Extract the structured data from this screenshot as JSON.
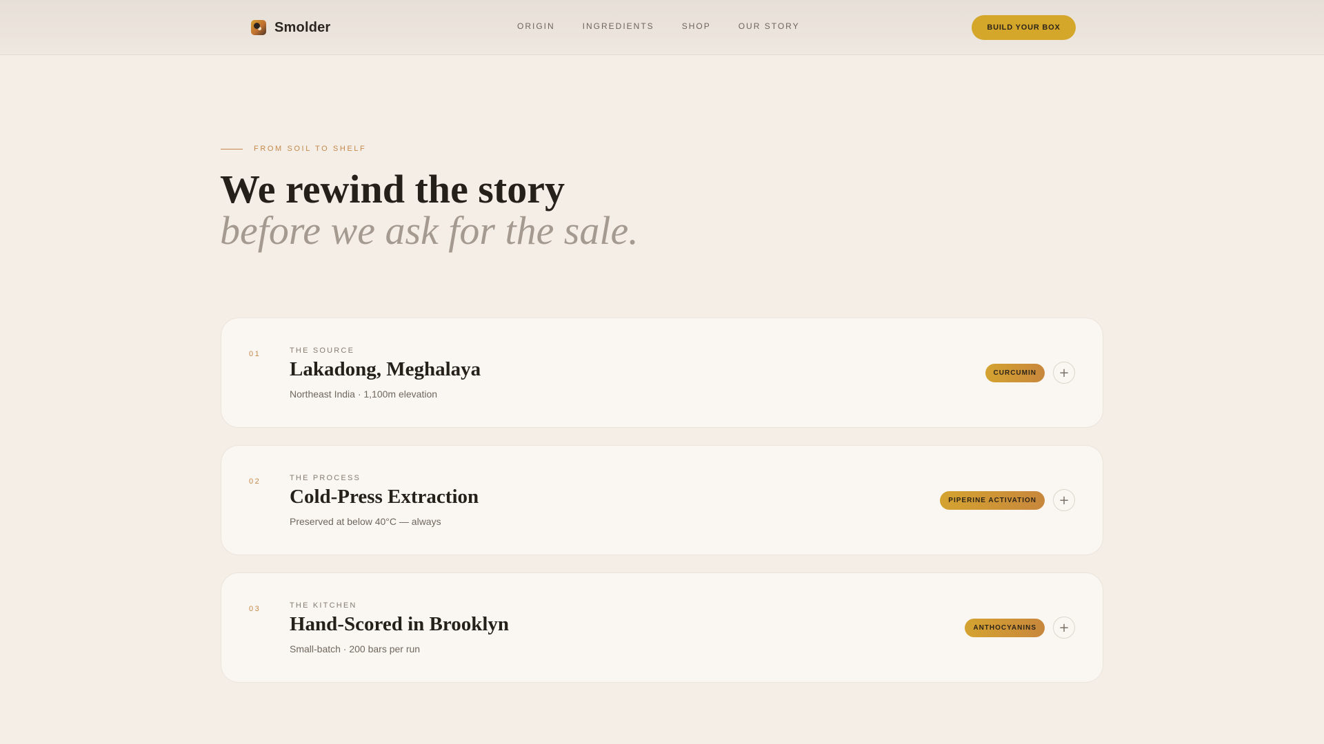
{
  "header": {
    "brand": "Smolder",
    "nav": [
      "ORIGIN",
      "INGREDIENTS",
      "SHOP",
      "OUR STORY"
    ],
    "cta": "BUILD YOUR BOX"
  },
  "hero": {
    "eyebrow": "FROM SOIL TO SHELF",
    "title_line1": "We rewind the story",
    "title_line2": "before we ask for the sale."
  },
  "cards": [
    {
      "num": "01",
      "label": "THE SOURCE",
      "title": "Lakadong, Meghalaya",
      "desc": "Northeast India · 1,100m elevation",
      "tag": "CURCUMIN"
    },
    {
      "num": "02",
      "label": "THE PROCESS",
      "title": "Cold-Press Extraction",
      "desc": "Preserved at below 40°C — always",
      "tag": "PIPERINE ACTIVATION"
    },
    {
      "num": "03",
      "label": "THE KITCHEN",
      "title": "Hand-Scored in Brooklyn",
      "desc": "Small-batch · 200 bars per run",
      "tag": "ANTHOCYANINS"
    }
  ],
  "icons": {
    "expand": "plus-icon",
    "logo": "brand-logo-icon"
  },
  "colors": {
    "background": "#f4eee7",
    "accent": "#d4a62a",
    "eyebrow": "#c4894a"
  }
}
